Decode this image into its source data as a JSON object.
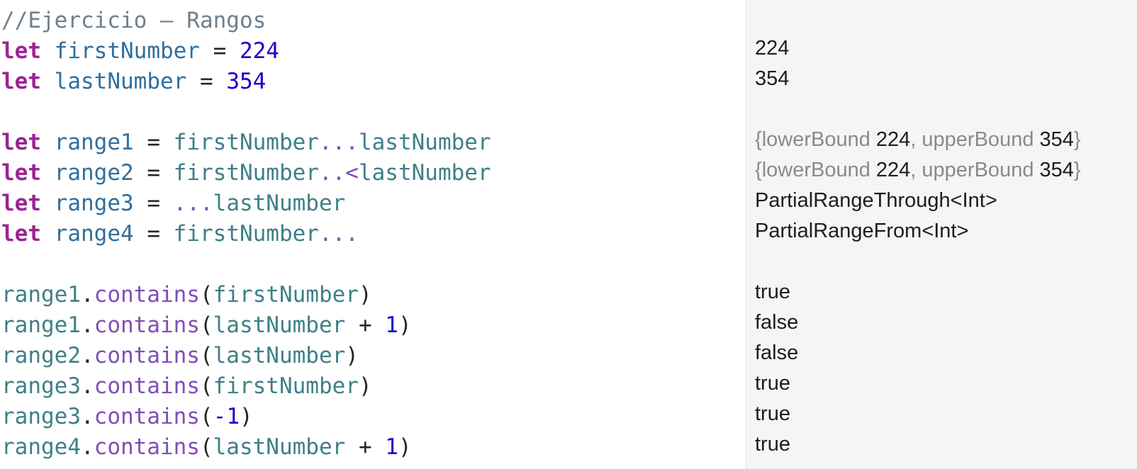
{
  "colors": {
    "comment": "#707f8c",
    "keyword": "#9b2393",
    "declaration": "#2f6f9e",
    "variable": "#3e8087",
    "number": "#1c00cf",
    "method": "#804fb8",
    "results_background": "#f5f5f5"
  },
  "code": {
    "comment": "//Ejercicio — Rangos",
    "let": "let",
    "eq": " = ",
    "first_number": "firstNumber",
    "last_number": "lastNumber",
    "range1": "range1",
    "range2": "range2",
    "range3": "range3",
    "range4": "range4",
    "value_first": "224",
    "value_last": "354",
    "closed_op": "...",
    "half_open_op": "..<",
    "dot": ".",
    "contains": "contains",
    "open_paren": "(",
    "close_paren": ")",
    "plus": " + ",
    "one": "1",
    "minus": "-"
  },
  "results": {
    "first_number": "224",
    "last_number": "354",
    "range1_open": "{",
    "lower_label": "lowerBound",
    "lower_value": "224",
    "comma": ", ",
    "upper_label": "upperBound",
    "upper_value": "354",
    "range_close": "}",
    "range3_type": "PartialRangeThrough<Int>",
    "range4_type": "PartialRangeFrom<Int>",
    "check1": "true",
    "check2": "false",
    "check3": "false",
    "check4": "true",
    "check5": "true",
    "check6": "true"
  }
}
